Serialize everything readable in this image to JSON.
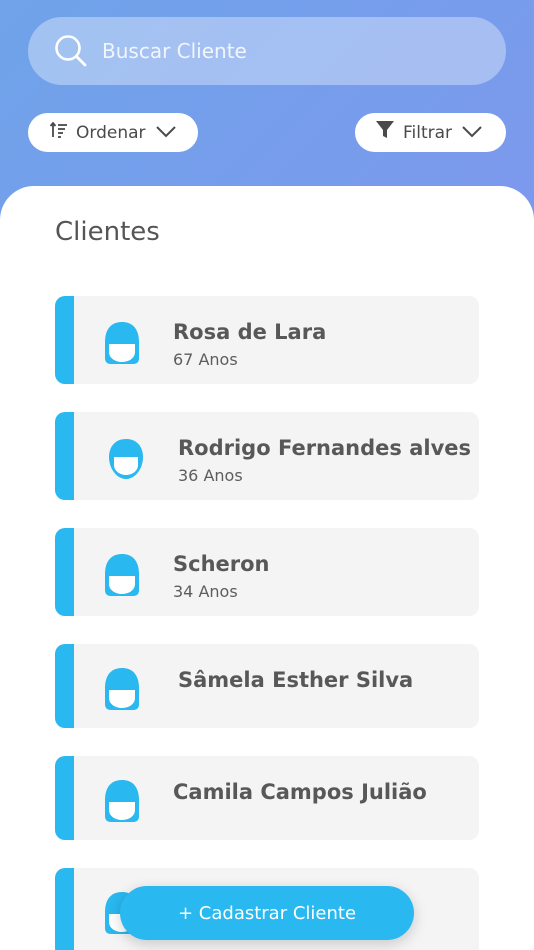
{
  "search": {
    "placeholder": "Buscar Cliente",
    "icon": "search-icon"
  },
  "toolbar": {
    "sort_label": "Ordenar",
    "filter_label": "Filtrar"
  },
  "section_title": "Clientes",
  "clients": [
    {
      "name": "Rosa de Lara",
      "age": "67 Anos",
      "avatar": "female-avatar-icon"
    },
    {
      "name": "Rodrigo Fernandes alves",
      "age": "36 Anos",
      "avatar": "male-avatar-icon"
    },
    {
      "name": "Scheron",
      "age": "34 Anos",
      "avatar": "female-avatar-icon"
    },
    {
      "name": "Sâmela Esther Silva",
      "age": "",
      "avatar": "female-avatar-icon"
    },
    {
      "name": "Camila Campos Julião",
      "age": "",
      "avatar": "female-avatar-icon"
    }
  ],
  "add_button_label": "+ Cadastrar Cliente",
  "colors": {
    "accent": "#29b8ef",
    "card_bg": "#f4f4f4",
    "text": "#585858"
  }
}
